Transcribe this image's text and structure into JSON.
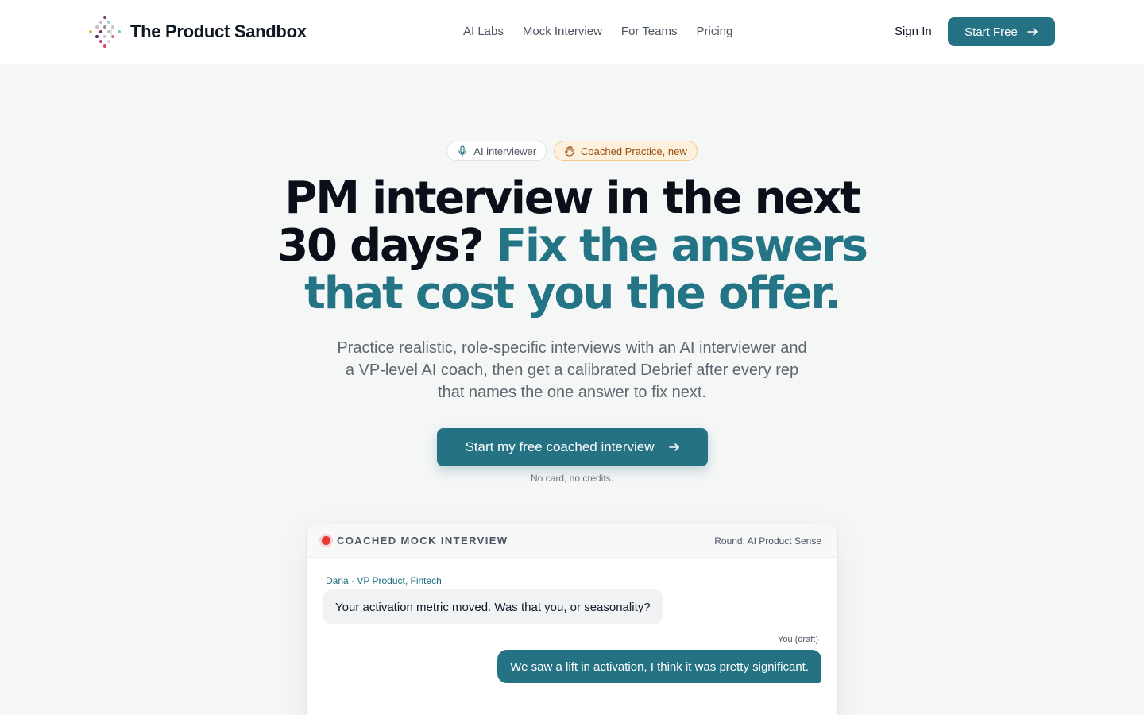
{
  "header": {
    "brand": "The Product Sandbox",
    "nav": [
      "AI Labs",
      "Mock Interview",
      "For Teams",
      "Pricing"
    ],
    "sign_in": "Sign In",
    "start_free": "Start Free"
  },
  "hero": {
    "badge_ai": "AI interviewer",
    "badge_coach": "Coached Practice, new",
    "headline_line1": "PM interview in the next",
    "headline_line2_dark": "30 days?",
    "headline_line2_accent": "Fix the answers",
    "headline_line3_accent": "that cost you the offer.",
    "subhead": "Practice realistic, role-specific interviews with an AI interviewer and a VP-level AI coach, then get a calibrated Debrief after every rep that names the one answer to fix next.",
    "cta": "Start my free coached interview",
    "cta_note": "No card, no credits."
  },
  "card": {
    "title": "COACHED MOCK INTERVIEW",
    "round": "Round: AI Product Sense",
    "interviewer_label": "Dana · VP Product, Fintech",
    "interviewer_message": "Your activation metric moved. Was that you, or seasonality?",
    "you_label": "You (draft)",
    "you_message": "We saw a lift in activation, I think it was pretty significant."
  },
  "colors": {
    "accent": "#247283",
    "headline_accent": "#237586",
    "badge_coach_bg": "#fdf0dc",
    "recording": "#e53935"
  }
}
